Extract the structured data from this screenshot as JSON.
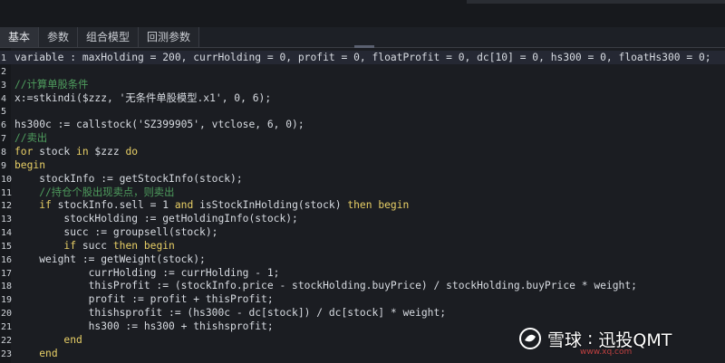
{
  "tabs": [
    {
      "label": "基本",
      "active": true
    },
    {
      "label": "参数",
      "active": false
    },
    {
      "label": "组合模型",
      "active": false
    },
    {
      "label": "回测参数",
      "active": false
    }
  ],
  "code_lines": [
    {
      "num": "1",
      "segs": [
        {
          "t": "variable : maxHolding = 200, currHolding = 0, profit = 0, floatProfit = 0, dc[10] = 0, hs300 = 0, floatHs300 = 0;",
          "c": "fn"
        }
      ],
      "highlight": true
    },
    {
      "num": "2",
      "segs": []
    },
    {
      "num": "3",
      "segs": [
        {
          "t": "//计算单股条件",
          "c": "cm"
        }
      ]
    },
    {
      "num": "4",
      "segs": [
        {
          "t": "x:=stkindi($zzz, '无条件单股模型.x1', 0, 6);",
          "c": "fn"
        }
      ]
    },
    {
      "num": "5",
      "segs": []
    },
    {
      "num": "6",
      "segs": [
        {
          "t": "hs300c := callstock('SZ399905', vtclose, 6, 0);",
          "c": "fn"
        }
      ]
    },
    {
      "num": "7",
      "segs": [
        {
          "t": "//卖出",
          "c": "cm"
        }
      ]
    },
    {
      "num": "8",
      "segs": [
        {
          "t": "for",
          "c": "kw"
        },
        {
          "t": " stock ",
          "c": "fn"
        },
        {
          "t": "in",
          "c": "kw"
        },
        {
          "t": " $zzz ",
          "c": "fn"
        },
        {
          "t": "do",
          "c": "kw"
        }
      ]
    },
    {
      "num": "9",
      "segs": [
        {
          "t": "begin",
          "c": "kw"
        }
      ]
    },
    {
      "num": "10",
      "segs": [
        {
          "t": "    stockInfo := getStockInfo(stock);",
          "c": "fn"
        }
      ]
    },
    {
      "num": "11",
      "segs": [
        {
          "t": "    //持仓个股出现卖点，则卖出",
          "c": "cm"
        }
      ]
    },
    {
      "num": "12",
      "segs": [
        {
          "t": "    ",
          "c": "fn"
        },
        {
          "t": "if",
          "c": "kw"
        },
        {
          "t": " stockInfo.sell = 1 ",
          "c": "fn"
        },
        {
          "t": "and",
          "c": "kw"
        },
        {
          "t": " isStockInHolding(stock) ",
          "c": "fn"
        },
        {
          "t": "then begin",
          "c": "kw"
        }
      ]
    },
    {
      "num": "13",
      "segs": [
        {
          "t": "        stockHolding := getHoldingInfo(stock);",
          "c": "fn"
        }
      ]
    },
    {
      "num": "14",
      "segs": [
        {
          "t": "        succ := groupsell(stock);",
          "c": "fn"
        }
      ]
    },
    {
      "num": "15",
      "segs": [
        {
          "t": "        ",
          "c": "fn"
        },
        {
          "t": "if",
          "c": "kw"
        },
        {
          "t": " succ ",
          "c": "fn"
        },
        {
          "t": "then begin",
          "c": "kw"
        }
      ]
    },
    {
      "num": "16",
      "segs": [
        {
          "t": "    weight := getWeight(stock);",
          "c": "fn"
        }
      ]
    },
    {
      "num": "17",
      "segs": [
        {
          "t": "            currHolding := currHolding - 1;",
          "c": "fn"
        }
      ]
    },
    {
      "num": "18",
      "segs": [
        {
          "t": "            thisProfit := (stockInfo.price - stockHolding.buyPrice) / stockHolding.buyPrice * weight;",
          "c": "fn"
        }
      ]
    },
    {
      "num": "19",
      "segs": [
        {
          "t": "            profit := profit + thisProfit;",
          "c": "fn"
        }
      ]
    },
    {
      "num": "20",
      "segs": [
        {
          "t": "            thishsprofit := (hs300c - dc[stock]) / dc[stock] * weight;",
          "c": "fn"
        }
      ]
    },
    {
      "num": "21",
      "segs": [
        {
          "t": "            hs300 := hs300 + thishsprofit;",
          "c": "fn"
        }
      ]
    },
    {
      "num": "22",
      "segs": [
        {
          "t": "        ",
          "c": "fn"
        },
        {
          "t": "end",
          "c": "kw"
        }
      ]
    },
    {
      "num": "23",
      "segs": [
        {
          "t": "    ",
          "c": "fn"
        },
        {
          "t": "end",
          "c": "kw"
        }
      ]
    }
  ],
  "watermark": {
    "brand": "雪球",
    "separator": ":",
    "author": "迅投QMT",
    "site": "www.xq.com"
  },
  "colors": {
    "keyword": "#e8cf66",
    "comment": "#4f9e5e",
    "text": "#d8dce2",
    "background": "#1b1d22"
  }
}
